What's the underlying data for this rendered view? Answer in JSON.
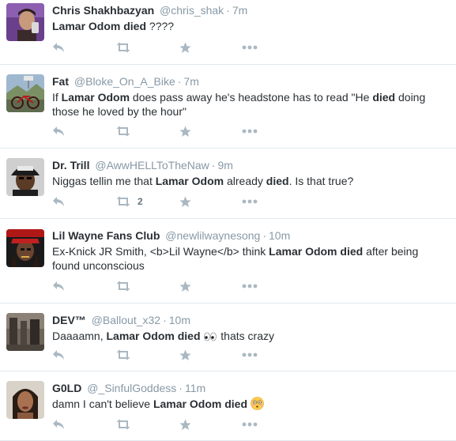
{
  "colors": {
    "action_icon": "#aab8c2",
    "meta": "#8899a6",
    "text": "#292f33",
    "divider": "#e1e8ed"
  },
  "tweets": [
    {
      "name": "Chris Shakhbazyan",
      "handle": "@chris_shak",
      "time": "7m",
      "segments": [
        {
          "b": true,
          "t": "Lamar Odom died"
        },
        {
          "b": false,
          "t": " ????"
        }
      ],
      "retweet_count": "",
      "avatar": "selfie-portrait"
    },
    {
      "name": "Fat",
      "handle": "@Bloke_On_A_Bike",
      "time": "7m",
      "segments": [
        {
          "b": false,
          "t": "If "
        },
        {
          "b": true,
          "t": "Lamar Odom"
        },
        {
          "b": false,
          "t": " does pass away he's headstone has to read \"He "
        },
        {
          "b": true,
          "t": "died"
        },
        {
          "b": false,
          "t": " doing those he loved by the hour\""
        }
      ],
      "retweet_count": "",
      "avatar": "bicycle-photo"
    },
    {
      "name": "Dr. Trill",
      "handle": "@AwwHELLToTheNaw",
      "time": "9m",
      "segments": [
        {
          "b": false,
          "t": "Niggas tellin me that "
        },
        {
          "b": true,
          "t": "Lamar Odom"
        },
        {
          "b": false,
          "t": " already "
        },
        {
          "b": true,
          "t": "died"
        },
        {
          "b": false,
          "t": ". Is that true?"
        }
      ],
      "retweet_count": "2",
      "avatar": "man-with-cap"
    },
    {
      "name": "Lil Wayne Fans Club",
      "handle": "@newlilwaynesong",
      "time": "10m",
      "segments": [
        {
          "b": false,
          "t": "Ex-Knick JR Smith, <b>Lil Wayne</b> think "
        },
        {
          "b": true,
          "t": "Lamar Odom died"
        },
        {
          "b": false,
          "t": " after being found unconscious"
        }
      ],
      "retweet_count": "",
      "avatar": "lil-wayne-photo"
    },
    {
      "name": "DEV™",
      "handle": "@Ballout_x32",
      "time": "10m",
      "segments": [
        {
          "b": false,
          "t": "Daaaamn, "
        },
        {
          "b": true,
          "t": "Lamar Odom died"
        },
        {
          "b": false,
          "t": " "
        },
        {
          "emoji": "eyes"
        },
        {
          "b": false,
          "t": " thats crazy"
        }
      ],
      "retweet_count": "",
      "avatar": "room-photo"
    },
    {
      "name": "G0LD",
      "handle": "@_SinfulGoddess",
      "time": "11m",
      "segments": [
        {
          "b": false,
          "t": "damn I can't believe "
        },
        {
          "b": true,
          "t": "Lamar Odom died"
        },
        {
          "b": false,
          "t": " "
        },
        {
          "emoji": "flushed-face"
        }
      ],
      "retweet_count": "",
      "avatar": "woman-portrait"
    }
  ]
}
